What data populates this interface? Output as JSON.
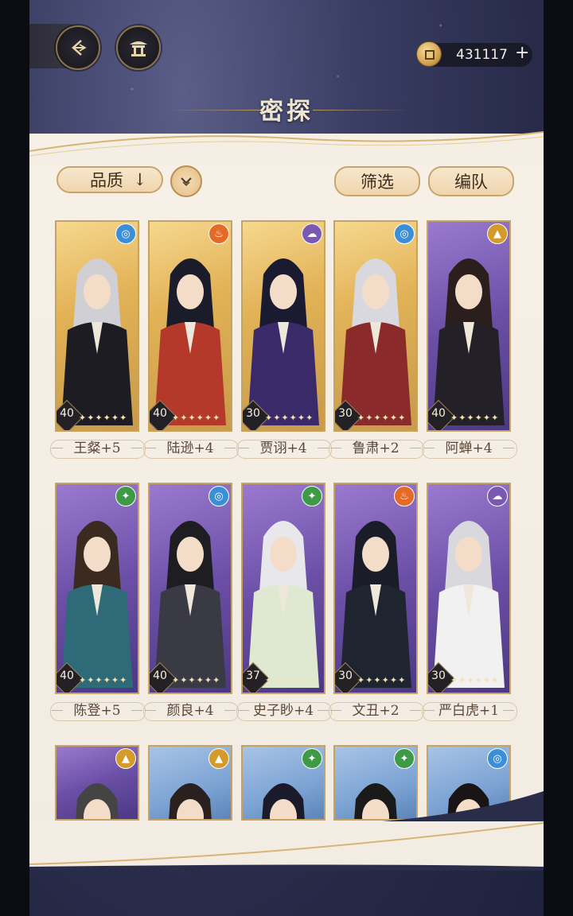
{
  "header": {
    "title": "密探",
    "currency_value": "431117",
    "currency_plus": "+"
  },
  "toolbar": {
    "sort_label": "品质",
    "sort_arrow": "↓",
    "filter_label": "筛选",
    "team_label": "编队"
  },
  "colors": {
    "accent_gold": "#c9a470",
    "panel_bg": "#f3ede3",
    "text_brown": "#5b4637"
  },
  "cards": [
    {
      "name": "王粲+5",
      "level": "40",
      "element": "water-icon",
      "frame": "gold"
    },
    {
      "name": "陆逊+4",
      "level": "40",
      "element": "fire-icon",
      "frame": "gold"
    },
    {
      "name": "贾诩+4",
      "level": "30",
      "element": "cloud-icon",
      "frame": "gold"
    },
    {
      "name": "鲁肃+2",
      "level": "30",
      "element": "water-icon",
      "frame": "gold"
    },
    {
      "name": "阿蝉+4",
      "level": "40",
      "element": "earth-icon",
      "frame": "purple"
    },
    {
      "name": "陈登+5",
      "level": "40",
      "element": "wind-icon",
      "frame": "purple"
    },
    {
      "name": "颜良+4",
      "level": "40",
      "element": "water-icon",
      "frame": "purple"
    },
    {
      "name": "史子眇+4",
      "level": "37",
      "element": "wind-icon",
      "frame": "purple"
    },
    {
      "name": "文丑+2",
      "level": "30",
      "element": "fire-icon",
      "frame": "purple"
    },
    {
      "name": "严白虎+1",
      "level": "30",
      "element": "cloud-icon",
      "frame": "purple"
    },
    {
      "name": "",
      "level": "",
      "element": "earth-icon",
      "frame": "purple"
    },
    {
      "name": "",
      "level": "",
      "element": "earth-icon",
      "frame": "blue"
    },
    {
      "name": "",
      "level": "",
      "element": "wind-icon",
      "frame": "blue"
    },
    {
      "name": "",
      "level": "",
      "element": "wind-icon",
      "frame": "blue"
    },
    {
      "name": "",
      "level": "",
      "element": "water-icon",
      "frame": "blue"
    }
  ]
}
